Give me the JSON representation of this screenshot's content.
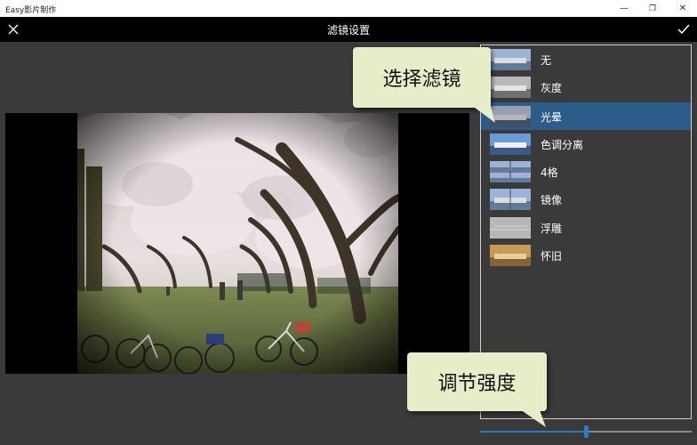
{
  "window": {
    "title": "Easy影片制作",
    "controls": {
      "minimize": "—",
      "restore": "❐",
      "close": "✕"
    }
  },
  "header": {
    "title": "滤镜设置",
    "close_icon": "close-icon",
    "confirm_icon": "checkmark-icon"
  },
  "filters": {
    "selected_index": 2,
    "items": [
      {
        "label": "无",
        "style": "normal"
      },
      {
        "label": "灰度",
        "style": "gray"
      },
      {
        "label": "光晕",
        "style": "glow"
      },
      {
        "label": "色调分离",
        "style": "posterize"
      },
      {
        "label": "4格",
        "style": "grid"
      },
      {
        "label": "镜像",
        "style": "mirror"
      },
      {
        "label": "浮雕",
        "style": "emboss"
      },
      {
        "label": "怀旧",
        "style": "sepia"
      }
    ]
  },
  "strength_slider": {
    "value_fraction": 0.5
  },
  "callouts": {
    "filter": "选择滤镜",
    "strength": "调节强度"
  },
  "colors": {
    "accent": "#2f79c6",
    "selected_row": "#2b5c8a",
    "callout_bg": "#e7edc8"
  }
}
